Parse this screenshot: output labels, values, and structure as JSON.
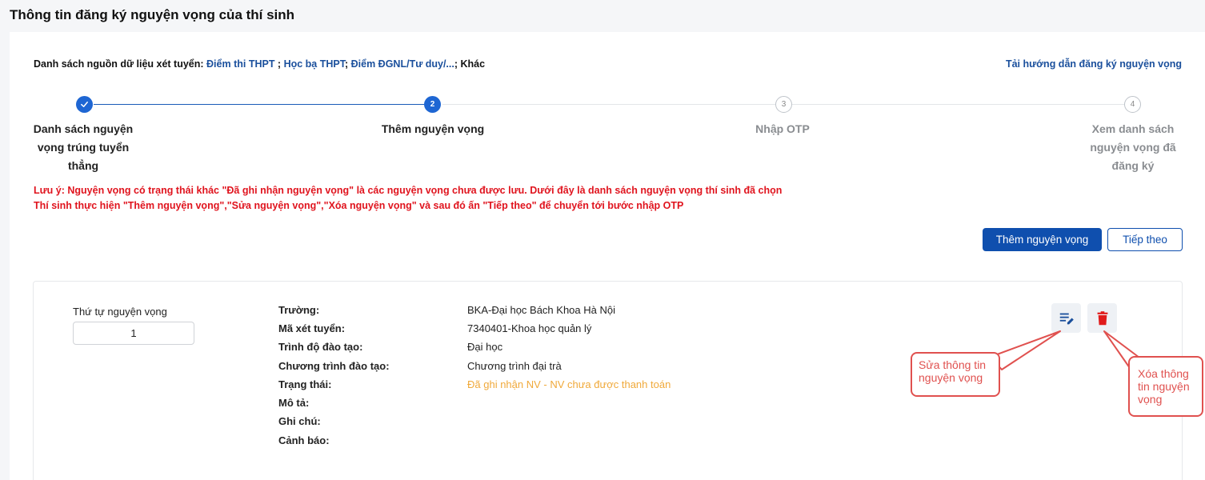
{
  "page_title": "Thông tin đăng ký nguyện vọng của thí sinh",
  "sources": {
    "prefix": "Danh sách nguồn dữ liệu xét tuyển:",
    "items": [
      "Điểm thi THPT",
      "Học bạ THPT",
      "Điểm ĐGNL/Tư duy/...",
      "Khác"
    ],
    "separators": [
      " ;",
      ";",
      ";"
    ]
  },
  "guide_link": "Tải hướng dẫn đăng ký nguyện vọng",
  "stepper": {
    "steps": [
      {
        "number": "✓",
        "label": [
          "Danh sách nguyện",
          "vọng trúng tuyển",
          "thẳng"
        ],
        "state": "done"
      },
      {
        "number": "2",
        "label": [
          "Thêm nguyện vọng"
        ],
        "state": "active"
      },
      {
        "number": "3",
        "label": [
          "Nhập OTP"
        ],
        "state": "todo"
      },
      {
        "number": "4",
        "label": [
          "Xem danh sách",
          "nguyện vọng đã",
          "đăng ký"
        ],
        "state": "todo"
      }
    ]
  },
  "notes": [
    "Lưu ý: Nguyện vọng có trạng thái khác \"Đã ghi nhận nguyện vọng\" là các nguyện vọng chưa được lưu. Dưới đây là danh sách nguyện vọng thí sinh đã chọn",
    "Thí sinh thực hiện \"Thêm nguyện vọng\",\"Sửa nguyện vọng\",\"Xóa nguyện vọng\" và sau đó ấn \"Tiếp theo\" để chuyển tới bước nhập OTP"
  ],
  "buttons": {
    "add": "Thêm nguyện vọng",
    "next": "Tiếp theo"
  },
  "aspiration": {
    "order_label": "Thứ tự nguyện vọng",
    "order_value": "1",
    "fields": [
      {
        "label": "Trường:",
        "value": "BKA-Đại học Bách Khoa Hà Nội"
      },
      {
        "label": "Mã xét tuyển:",
        "value": "7340401-Khoa học quản lý"
      },
      {
        "label": "Trình độ đào tạo:",
        "value": "Đại học"
      },
      {
        "label": "Chương trình đào tạo:",
        "value": "Chương trình đại trà"
      },
      {
        "label": "Trạng thái:",
        "value": "Đã ghi nhận NV - NV chưa được thanh toán"
      },
      {
        "label": "Mô tả:",
        "value": ""
      },
      {
        "label": "Ghi chú:",
        "value": ""
      },
      {
        "label": "Cảnh báo:",
        "value": ""
      }
    ],
    "icons": {
      "edit": "edit-list-icon",
      "delete": "trash-icon"
    }
  },
  "callouts": {
    "edit": [
      "Sửa thông tin",
      "nguyện vọng"
    ],
    "delete": [
      "Xóa thông",
      "tin nguyện",
      "vọng"
    ]
  },
  "colors": {
    "primary": "#0f4fae",
    "step_active": "#1e66d3",
    "note": "#e0141e",
    "status": "#f0a93a",
    "delete": "#e01b1b",
    "callout": "#e0514f"
  }
}
